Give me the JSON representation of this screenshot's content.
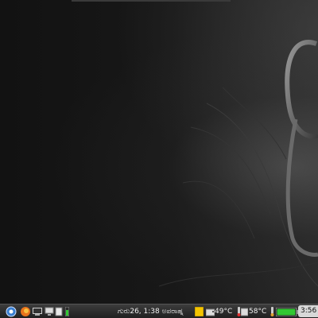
{
  "panel": {
    "datetime": "ಗುರು26, 1:38 ಅಪರಾಹ್ನ",
    "temp_1": "49°C",
    "temp_2": "58°C",
    "battery_time": "3:56"
  },
  "icons": {
    "menu": "main-menu-icon",
    "browser": "firefox-icon",
    "terminal": "terminal-icon",
    "network": "network-icon",
    "files": "file-manager-icon",
    "battery_small": "battery-indicator-icon",
    "notes": "notes-icon",
    "drive": "drive-icon",
    "thermo": "thermometer-icon",
    "battery": "battery-icon"
  },
  "colors": {
    "panel_text": "#f0f0f0",
    "battery_fill": "#32c832",
    "notes_yellow": "#f4c400"
  }
}
